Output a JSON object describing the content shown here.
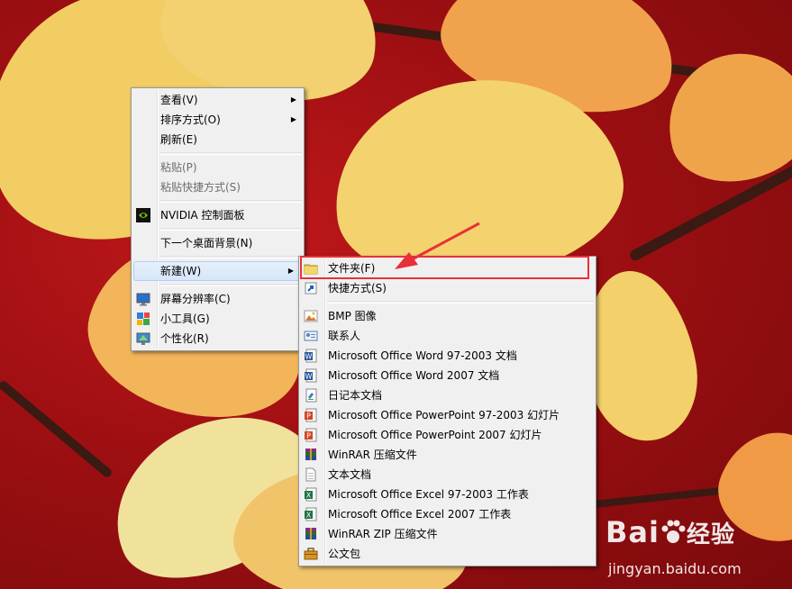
{
  "context_menu": {
    "items": [
      {
        "label": "查看(V)",
        "has_submenu": true
      },
      {
        "label": "排序方式(O)",
        "has_submenu": true
      },
      {
        "label": "刷新(E)"
      },
      {
        "label": "粘贴(P)",
        "disabled": true
      },
      {
        "label": "粘贴快捷方式(S)",
        "disabled": true
      },
      {
        "label": "NVIDIA 控制面板",
        "icon": "nvidia-icon"
      },
      {
        "label": "下一个桌面背景(N)"
      },
      {
        "label": "新建(W)",
        "has_submenu": true,
        "highlighted": true
      },
      {
        "label": "屏幕分辨率(C)",
        "icon": "monitor-icon"
      },
      {
        "label": "小工具(G)",
        "icon": "gadgets-icon"
      },
      {
        "label": "个性化(R)",
        "icon": "personalize-icon"
      }
    ]
  },
  "new_submenu": {
    "items": [
      {
        "label": "文件夹(F)",
        "icon": "folder-icon"
      },
      {
        "label": "快捷方式(S)",
        "icon": "shortcut-icon"
      },
      {
        "label": "BMP 图像",
        "icon": "bmp-image-icon"
      },
      {
        "label": "联系人",
        "icon": "contact-icon"
      },
      {
        "label": "Microsoft Office Word 97-2003 文档",
        "icon": "word-icon"
      },
      {
        "label": "Microsoft Office Word 2007 文档",
        "icon": "word-icon"
      },
      {
        "label": "日记本文档",
        "icon": "journal-icon"
      },
      {
        "label": "Microsoft Office PowerPoint 97-2003 幻灯片",
        "icon": "powerpoint-icon"
      },
      {
        "label": "Microsoft Office PowerPoint 2007 幻灯片",
        "icon": "powerpoint-icon"
      },
      {
        "label": "WinRAR 压缩文件",
        "icon": "winrar-icon"
      },
      {
        "label": "文本文档",
        "icon": "text-document-icon"
      },
      {
        "label": "Microsoft Office Excel 97-2003 工作表",
        "icon": "excel-icon"
      },
      {
        "label": "Microsoft Office Excel 2007 工作表",
        "icon": "excel-icon"
      },
      {
        "label": "WinRAR ZIP 压缩文件",
        "icon": "winrar-zip-icon"
      },
      {
        "label": "公文包",
        "icon": "briefcase-icon"
      }
    ]
  },
  "watermark": {
    "logo": "Bai",
    "logo_cn": "经验",
    "url": "jingyan.baidu.com"
  },
  "colors": {
    "annotation": "#e8303a",
    "menu_bg": "#f0f0f0",
    "highlight": "#d6e6f9"
  }
}
